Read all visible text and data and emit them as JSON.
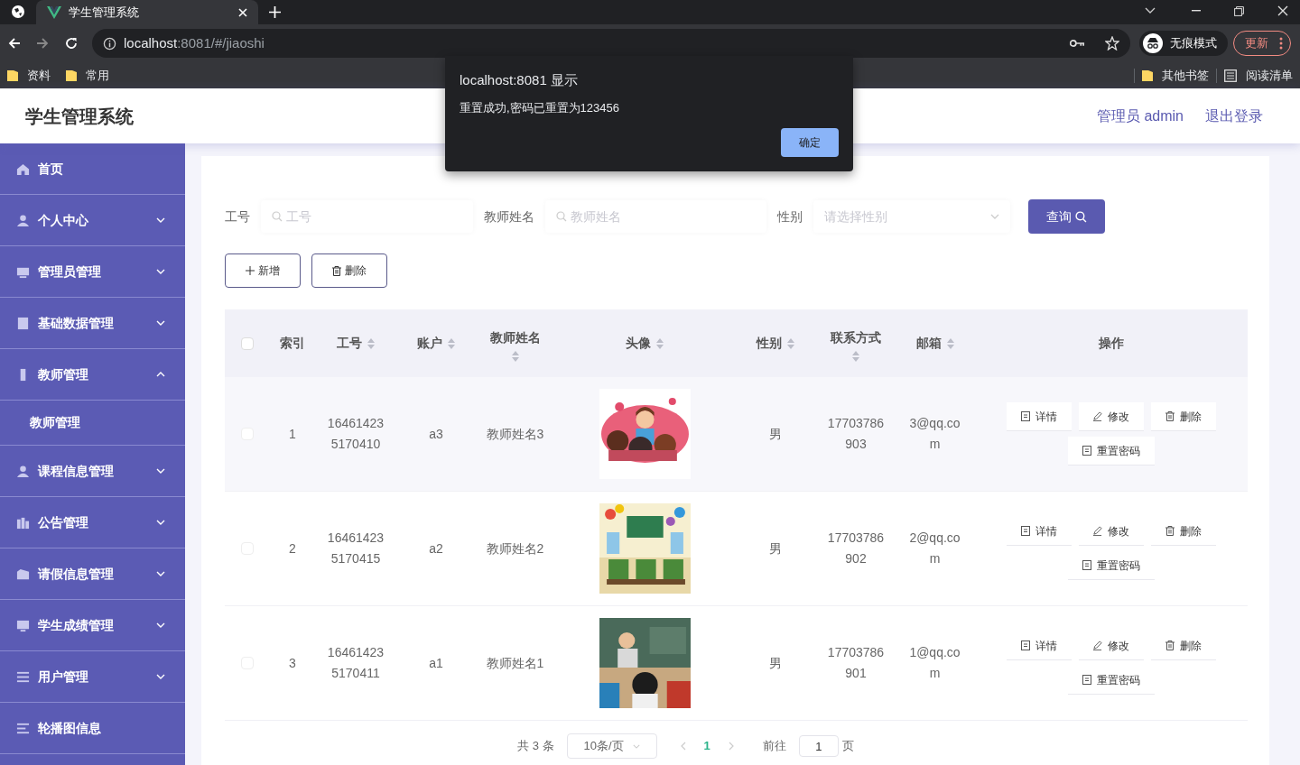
{
  "browser": {
    "tab_title": "学生管理系统",
    "url_host": "localhost",
    "url_rest": ":8081/#/jiaoshi",
    "profile": "无痕模式",
    "update": "更新",
    "bookmarks": [
      "资料",
      "常用"
    ],
    "right_bookmarks": [
      {
        "label": "其他书签",
        "kind": "folder"
      },
      {
        "label": "阅读清单",
        "kind": "list"
      }
    ]
  },
  "dialog": {
    "title": "localhost:8081 显示",
    "message": "重置成功,密码已重置为123456",
    "button": "确定"
  },
  "header": {
    "title": "学生管理系统",
    "user": "管理员 admin",
    "logout": "退出登录"
  },
  "sidebar": {
    "items": [
      {
        "label": "首页"
      },
      {
        "label": "个人中心",
        "expanded": false
      },
      {
        "label": "管理员管理",
        "expanded": false
      },
      {
        "label": "基础数据管理",
        "expanded": false
      },
      {
        "label": "教师管理",
        "expanded": true,
        "children": [
          {
            "label": "教师管理"
          }
        ]
      },
      {
        "label": "课程信息管理",
        "expanded": false
      },
      {
        "label": "公告管理",
        "expanded": false
      },
      {
        "label": "请假信息管理",
        "expanded": false
      },
      {
        "label": "学生成绩管理",
        "expanded": false
      },
      {
        "label": "用户管理",
        "expanded": false
      },
      {
        "label": "轮播图信息"
      }
    ]
  },
  "search": {
    "fields": [
      {
        "label": "工号",
        "placeholder": "工号",
        "kind": "text"
      },
      {
        "label": "教师姓名",
        "placeholder": "教师姓名",
        "kind": "text"
      },
      {
        "label": "性别",
        "placeholder": "请选择性别",
        "kind": "select"
      }
    ],
    "button": "查询"
  },
  "actions": [
    {
      "label": "新增",
      "kind": "add"
    },
    {
      "label": "删除",
      "kind": "delete"
    }
  ],
  "table": {
    "select_all": {
      "checked": false
    },
    "columns": [
      {
        "label": "索引",
        "sortable": false
      },
      {
        "label": "工号",
        "sortable": true
      },
      {
        "label": "账户",
        "sortable": true
      },
      {
        "label": "教师姓名",
        "sortable": true
      },
      {
        "label": "头像",
        "sortable": true
      },
      {
        "label": "性别",
        "sortable": true
      },
      {
        "label": "联系方式",
        "sortable": true
      },
      {
        "label": "邮箱",
        "sortable": true
      },
      {
        "label": "操作",
        "sortable": false
      }
    ],
    "rows": [
      {
        "selected": false,
        "index": "1",
        "id": "164614235170410",
        "account": "a3",
        "name": "教师姓名3",
        "gender": "男",
        "phone": "17703786903",
        "email": "3@qq.com",
        "actions": [
          {
            "label": "详情",
            "kind": "detail"
          },
          {
            "label": "修改",
            "kind": "edit"
          },
          {
            "label": "删除",
            "kind": "delete"
          },
          {
            "label": "重置密码",
            "kind": "detail"
          }
        ]
      },
      {
        "selected": false,
        "index": "2",
        "id": "164614235170415",
        "account": "a2",
        "name": "教师姓名2",
        "gender": "男",
        "phone": "17703786902",
        "email": "2@qq.com",
        "actions": [
          {
            "label": "详情",
            "kind": "detail"
          },
          {
            "label": "修改",
            "kind": "edit"
          },
          {
            "label": "删除",
            "kind": "delete"
          },
          {
            "label": "重置密码",
            "kind": "detail"
          }
        ]
      },
      {
        "selected": false,
        "index": "3",
        "id": "164614235170411",
        "account": "a1",
        "name": "教师姓名1",
        "gender": "男",
        "phone": "17703786901",
        "email": "1@qq.com",
        "actions": [
          {
            "label": "详情",
            "kind": "detail"
          },
          {
            "label": "修改",
            "kind": "edit"
          },
          {
            "label": "删除",
            "kind": "delete"
          },
          {
            "label": "重置密码",
            "kind": "detail"
          }
        ]
      }
    ]
  },
  "pagination": {
    "total": "共 3 条",
    "page_size": "10条/页",
    "pages": [
      {
        "label": "1",
        "selected": true
      }
    ],
    "goto_label": "前往",
    "goto_value": "1",
    "goto_suffix": "页"
  }
}
